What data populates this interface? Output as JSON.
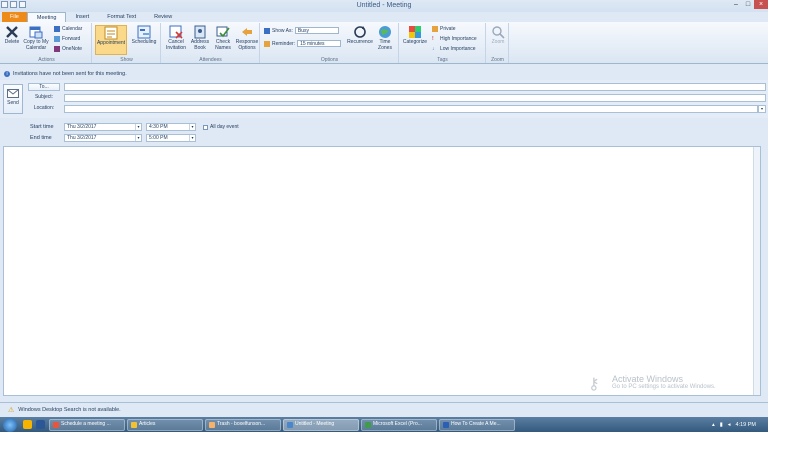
{
  "window": {
    "title": "Untitled - Meeting"
  },
  "tabs": [
    "File",
    "Meeting",
    "Insert",
    "Format Text",
    "Review"
  ],
  "ribbon": {
    "actions": {
      "label": "Actions",
      "delete": "Delete",
      "copy_calendar": "Copy to My Calendar",
      "calendar": "Calendar",
      "forward": "Forward",
      "onenote": "OneNote"
    },
    "show": {
      "label": "Show",
      "appointment": "Appointment",
      "scheduling": "Scheduling"
    },
    "attendees": {
      "label": "Attendees",
      "cancel": "Cancel Invitation",
      "address_book": "Address Book",
      "check_names": "Check Names",
      "response_options": "Response Options"
    },
    "options": {
      "label": "Options",
      "show_as": "Show As:",
      "show_as_value": "Busy",
      "reminder": "Reminder:",
      "reminder_value": "15 minutes",
      "recurrence": "Recurrence",
      "time_zones": "Time Zones"
    },
    "tags": {
      "label": "Tags",
      "categorize": "Categorize",
      "private": "Private",
      "high": "High Importance",
      "low": "Low Importance"
    },
    "zoom": {
      "label": "Zoom",
      "zoom": "Zoom"
    }
  },
  "info_message": "Invitations have not been sent for this meeting.",
  "form": {
    "send": "Send",
    "to": "To...",
    "subject": "Subject:",
    "location": "Location:",
    "start_label": "Start time",
    "end_label": "End time",
    "start_date": "Thu 3/2/2017",
    "start_time": "4:30 PM",
    "end_date": "Thu 3/2/2017",
    "end_time": "5:00 PM",
    "all_day": "All day event"
  },
  "watermark": {
    "title": "Activate Windows",
    "sub": "Go to PC settings to activate Windows."
  },
  "status": "Windows Desktop Search is not available.",
  "taskbar": {
    "tasks": [
      {
        "label": "Schedule a meeting ...",
        "color": "#e8553a"
      },
      {
        "label": "Articles",
        "color": "#f1c232"
      },
      {
        "label": "Trash - boxelfunson...",
        "color": "#f6b26b"
      },
      {
        "label": "Untitled - Meeting",
        "color": "#4a86c8"
      },
      {
        "label": "Microsoft Excel (Pro...",
        "color": "#3f9c49"
      },
      {
        "label": "How To Create A Me...",
        "color": "#2b5fb4"
      }
    ],
    "clock": "4:19 PM"
  },
  "colors": {
    "accent": "#ee8a1a",
    "ribbon_bg": "#dfe9f5",
    "taskbar": "#3d6489"
  }
}
